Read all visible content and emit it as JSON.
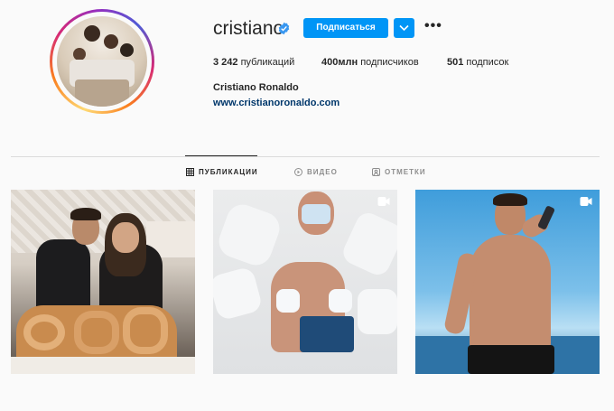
{
  "profile": {
    "username": "cristiano",
    "full_name": "Cristiano Ronaldo",
    "website": "www.cristianoronaldo.com",
    "verified": true,
    "follow_label": "Подписаться",
    "more_label": "•••",
    "stats": {
      "posts_count": "3 242",
      "posts_label": "публикаций",
      "followers_count": "400млн",
      "followers_label": "подписчиков",
      "following_count": "501",
      "following_label": "подписок"
    }
  },
  "tabs": [
    {
      "label": "ПУБЛИКАЦИИ",
      "icon": "grid-icon",
      "active": true
    },
    {
      "label": "ВИДЕО",
      "icon": "play-circle-icon",
      "active": false
    },
    {
      "label": "ОТМЕТКИ",
      "icon": "tagged-icon",
      "active": false
    }
  ],
  "posts": [
    {
      "type": "image",
      "icon": null
    },
    {
      "type": "video",
      "icon": "video-icon"
    },
    {
      "type": "video",
      "icon": "video-icon"
    }
  ],
  "colors": {
    "accent": "#0095f6",
    "verified": "#3897f0",
    "link": "#00376b",
    "text": "#262626",
    "muted": "#8e8e8e",
    "background": "#fafafa",
    "divider": "#dbdbdb"
  }
}
